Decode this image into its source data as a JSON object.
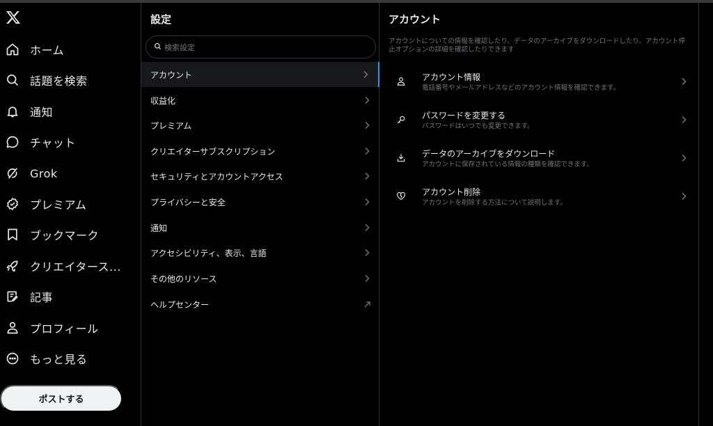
{
  "nav": {
    "items": [
      {
        "label": "ホーム",
        "icon": "home-icon"
      },
      {
        "label": "話題を検索",
        "icon": "search-icon"
      },
      {
        "label": "通知",
        "icon": "bell-icon"
      },
      {
        "label": "チャット",
        "icon": "chat-icon"
      },
      {
        "label": "Grok",
        "icon": "grok-icon"
      },
      {
        "label": "プレミアム",
        "icon": "verified-icon"
      },
      {
        "label": "ブックマーク",
        "icon": "bookmark-icon"
      },
      {
        "label": "クリエイタース...",
        "icon": "rocket-icon"
      },
      {
        "label": "記事",
        "icon": "article-icon"
      },
      {
        "label": "プロフィール",
        "icon": "person-icon"
      },
      {
        "label": "もっと見る",
        "icon": "more-icon"
      }
    ],
    "post_button": "ポストする"
  },
  "settings": {
    "title": "設定",
    "search_placeholder": "検索設定",
    "items": [
      {
        "label": "アカウント",
        "active": true
      },
      {
        "label": "収益化"
      },
      {
        "label": "プレミアム"
      },
      {
        "label": "クリエイターサブスクリプション"
      },
      {
        "label": "セキュリティとアカウントアクセス"
      },
      {
        "label": "プライバシーと安全"
      },
      {
        "label": "通知"
      },
      {
        "label": "アクセシビリティ、表示、言語"
      },
      {
        "label": "その他のリソース"
      },
      {
        "label": "ヘルプセンター",
        "external": true
      }
    ]
  },
  "account": {
    "title": "アカウント",
    "description": "アカウントについての情報を確認したり、データのアーカイブをダウンロードしたり、アカウント停止オプションの詳細を確認したりできます",
    "items": [
      {
        "title": "アカウント情報",
        "subtitle": "電話番号やメールアドレスなどのアカウント情報を確認できます。",
        "icon": "person-icon"
      },
      {
        "title": "パスワードを変更する",
        "subtitle": "パスワードはいつでも変更できます。",
        "icon": "key-icon"
      },
      {
        "title": "データのアーカイブをダウンロード",
        "subtitle": "アカウントに保存されている情報の種類を確認できます。",
        "icon": "download-icon"
      },
      {
        "title": "アカウント削除",
        "subtitle": "アカウントを削除する方法について説明します。",
        "icon": "broken-heart-icon"
      }
    ]
  },
  "colors": {
    "background": "#000000",
    "accent": "#1d9bf0",
    "text": "#e7e9ea",
    "muted": "#71767b",
    "border": "#2f3336"
  }
}
